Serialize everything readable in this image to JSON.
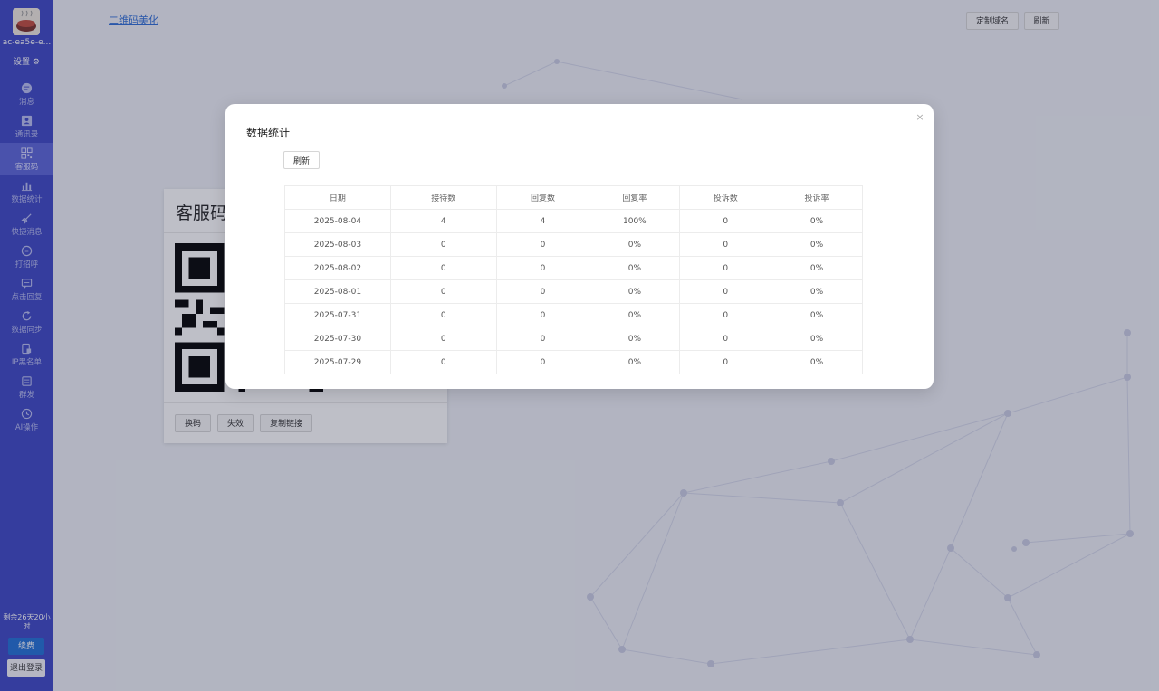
{
  "sidebar": {
    "account_name": "ac-ea5e-e...",
    "settings_label": "设置",
    "items": [
      {
        "label": "消息",
        "icon": "chat-icon"
      },
      {
        "label": "通讯录",
        "icon": "contacts-icon"
      },
      {
        "label": "客服码",
        "icon": "qr-icon"
      },
      {
        "label": "数据统计",
        "icon": "chart-icon"
      },
      {
        "label": "快捷消息",
        "icon": "rocket-icon"
      },
      {
        "label": "打招呼",
        "icon": "greet-icon"
      },
      {
        "label": "点击回复",
        "icon": "reply-icon"
      },
      {
        "label": "数据同步",
        "icon": "sync-icon"
      },
      {
        "label": "IP黑名单",
        "icon": "blacklist-icon"
      },
      {
        "label": "群发",
        "icon": "broadcast-icon"
      },
      {
        "label": "AI操作",
        "icon": "ai-icon"
      }
    ],
    "remaining": "剩余26天20小时",
    "renew_label": "续费",
    "logout_label": "退出登录"
  },
  "topbar": {
    "link_label": "二维码美化",
    "custom_domain_label": "定制域名",
    "refresh_label": "刷新"
  },
  "qr_card": {
    "title": "客服码",
    "change_code_label": "换码",
    "invalidate_label": "失效",
    "copy_link_label": "复制链接"
  },
  "modal": {
    "title": "数据统计",
    "close_symbol": "×",
    "refresh_label": "刷新",
    "columns": [
      "日期",
      "接待数",
      "回复数",
      "回复率",
      "投诉数",
      "投诉率"
    ],
    "rows": [
      [
        "2025-08-04",
        "4",
        "4",
        "100%",
        "0",
        "0%"
      ],
      [
        "2025-08-03",
        "0",
        "0",
        "0%",
        "0",
        "0%"
      ],
      [
        "2025-08-02",
        "0",
        "0",
        "0%",
        "0",
        "0%"
      ],
      [
        "2025-08-01",
        "0",
        "0",
        "0%",
        "0",
        "0%"
      ],
      [
        "2025-07-31",
        "0",
        "0",
        "0%",
        "0",
        "0%"
      ],
      [
        "2025-07-30",
        "0",
        "0",
        "0%",
        "0",
        "0%"
      ],
      [
        "2025-07-29",
        "0",
        "0",
        "0%",
        "0",
        "0%"
      ]
    ]
  },
  "colors": {
    "sidebar_bg": "#3b45c4",
    "renew_button": "#1f6fd6",
    "link": "#2b6bd6"
  }
}
